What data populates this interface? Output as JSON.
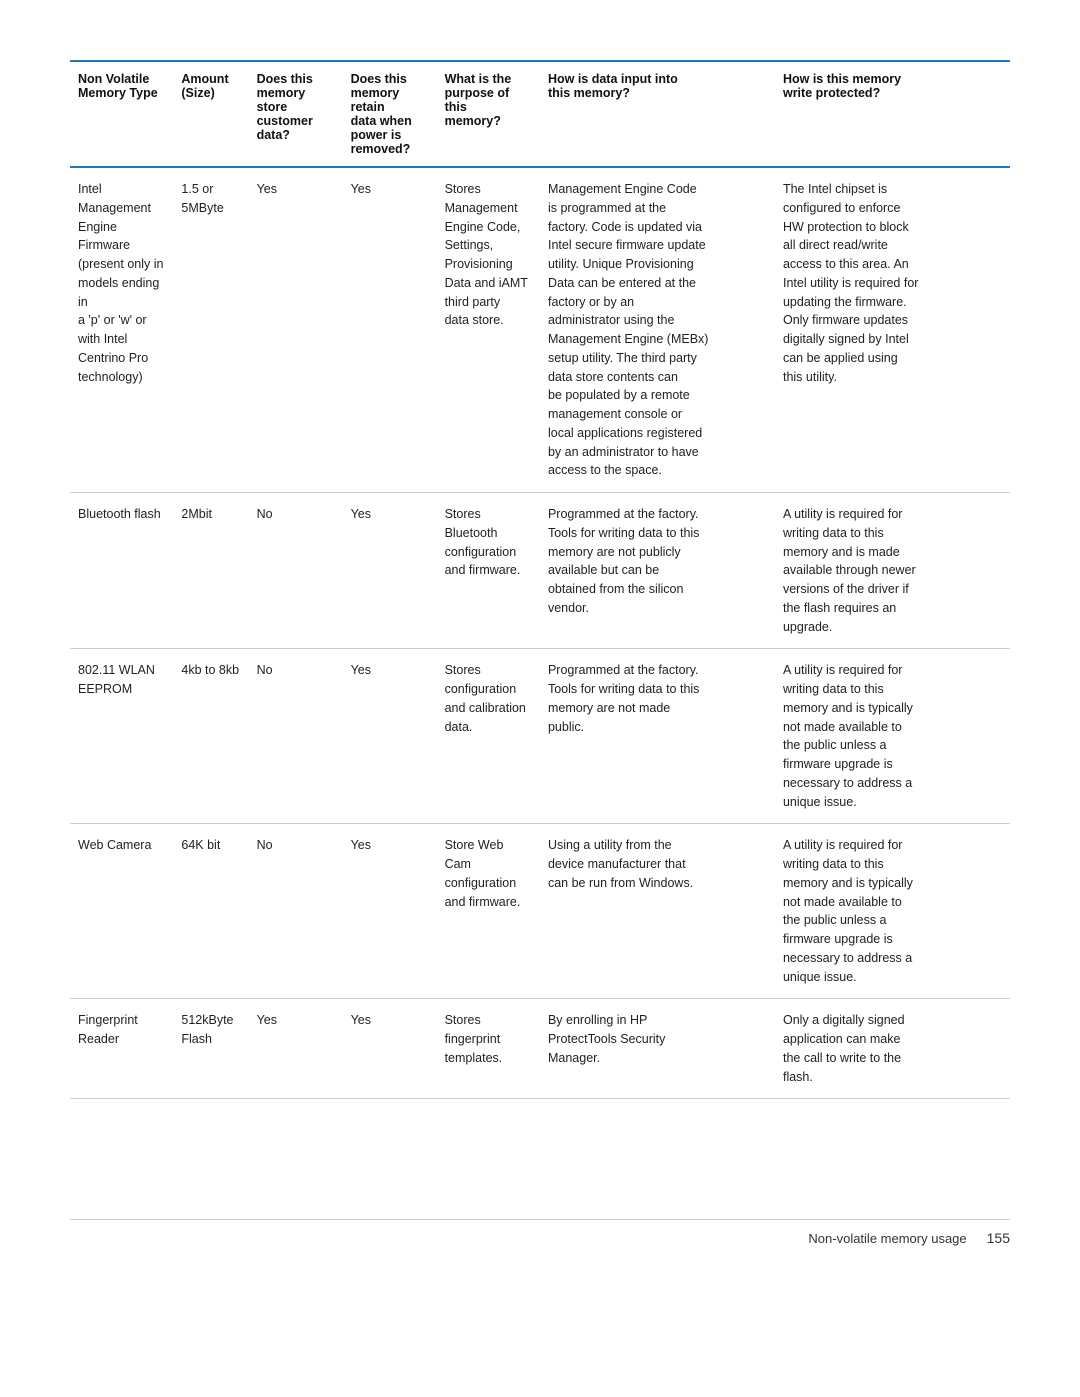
{
  "table": {
    "columns": [
      {
        "id": "col-memory-type",
        "label": "Non Volatile\nMemory Type"
      },
      {
        "id": "col-amount",
        "label": "Amount\n(Size)"
      },
      {
        "id": "col-store",
        "label": "Does this\nmemory\nstore\ncustomer\ndata?"
      },
      {
        "id": "col-retain",
        "label": "Does this\nmemory\nretain\ndata when\npower is\nremoved?"
      },
      {
        "id": "col-purpose",
        "label": "What is the\npurpose of\nthis\nmemory?"
      },
      {
        "id": "col-input",
        "label": "How is data input into\nthis memory?"
      },
      {
        "id": "col-protected",
        "label": "How is this memory\nwrite protected?"
      }
    ],
    "rows": [
      {
        "type": "Intel\nManagement\nEngine Firmware\n(present only in\nmodels ending in\na 'p' or 'w' or\nwith Intel\nCentrino Pro\ntechnology)",
        "amount": "1.5 or\n5MByte",
        "store": "Yes",
        "retain": "Yes",
        "purpose": "Stores\nManagement\nEngine Code,\nSettings,\nProvisioning\nData and iAMT\nthird party\ndata store.",
        "input": "Management Engine Code\nis programmed at the\nfactory. Code is updated via\nIntel secure firmware update\nutility. Unique Provisioning\nData can be entered at the\nfactory or by an\nadministrator using the\nManagement Engine (MEBx)\nsetup utility. The third party\ndata store contents can\nbe populated by a remote\nmanagement console or\nlocal applications registered\nby an administrator to have\naccess to the space.",
        "protected": "The Intel chipset is\nconfigured to enforce\nHW protection to block\nall direct read/write\naccess to this area. An\nIntel utility is required for\nupdating the firmware.\nOnly firmware updates\ndigitally signed by Intel\ncan be applied using\nthis utility."
      },
      {
        "type": "Bluetooth flash",
        "amount": "2Mbit",
        "store": "No",
        "retain": "Yes",
        "purpose": "Stores\nBluetooth\nconfiguration\nand firmware.",
        "input": "Programmed at the factory.\nTools for writing data to this\nmemory are not publicly\navailable but can be\nobtained from the silicon\nvendor.",
        "protected": "A utility is required for\nwriting data to this\nmemory and is made\navailable through newer\nversions of the driver if\nthe flash requires an\nupgrade."
      },
      {
        "type": "802.11 WLAN\nEEPROM",
        "amount": "4kb to 8kb",
        "store": "No",
        "retain": "Yes",
        "purpose": "Stores\nconfiguration\nand calibration\ndata.",
        "input": "Programmed at the factory.\nTools for writing data to this\nmemory are not made\npublic.",
        "protected": "A utility is required for\nwriting data to this\nmemory and is typically\nnot made available to\nthe public unless a\nfirmware upgrade is\nnecessary to address a\nunique issue."
      },
      {
        "type": "Web Camera",
        "amount": "64K bit",
        "store": "No",
        "retain": "Yes",
        "purpose": "Store Web\nCam\nconfiguration\nand firmware.",
        "input": "Using a utility from the\ndevice manufacturer that\ncan be run from Windows.",
        "protected": "A utility is required for\nwriting data to this\nmemory and is typically\nnot made available to\nthe public unless a\nfirmware upgrade is\nnecessary to address a\nunique issue."
      },
      {
        "type": "Fingerprint\nReader",
        "amount": "512kByte\nFlash",
        "store": "Yes",
        "retain": "Yes",
        "purpose": "Stores\nfingerprint\ntemplates.",
        "input": "By enrolling in HP\nProtectTools Security\nManager.",
        "protected": "Only a digitally signed\napplication can make\nthe call to write to the\nflash."
      }
    ]
  },
  "footer": {
    "text": "Non-volatile memory usage",
    "page": "155"
  }
}
